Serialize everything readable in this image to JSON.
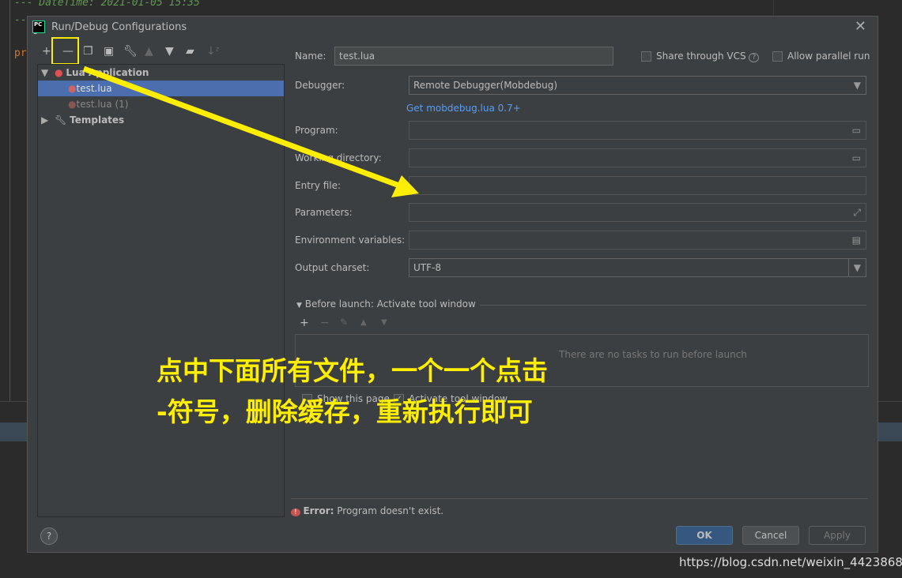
{
  "editor": {
    "comment_line": "--- DateTime: 2021-01-05 15:35",
    "dash_line": "--",
    "code_fragment": "pr"
  },
  "dialog": {
    "title": "Run/Debug Configurations",
    "toolbar": [
      "add-icon",
      "remove-icon",
      "copy-icon",
      "save-icon",
      "wrench-icon",
      "move-up-icon",
      "move-down-icon",
      "folder-add-icon",
      "sort-icon"
    ],
    "tree": {
      "group": "Lua Application",
      "items": [
        {
          "label": "test.lua",
          "selected": true
        },
        {
          "label": "test.lua (1)",
          "selected": false
        }
      ],
      "templates": "Templates"
    },
    "form": {
      "name_label": "Name:",
      "name_value": "test.lua",
      "share_vcs": "Share through VCS",
      "allow_parallel": "Allow parallel run",
      "debugger_label": "Debugger:",
      "debugger_value": "Remote Debugger(Mobdebug)",
      "mobdebug_link": "Get mobdebug.lua 0.7+",
      "program_label": "Program:",
      "program_value": "",
      "workdir_label": "Working directory:",
      "workdir_value": "",
      "entry_label": "Entry file:",
      "entry_value": "",
      "params_label": "Parameters:",
      "params_value": "",
      "env_label": "Environment variables:",
      "env_value": "",
      "charset_label": "Output charset:",
      "charset_value": "UTF-8"
    },
    "before_launch": {
      "title": "Before launch: Activate tool window",
      "empty": "There are no tasks to run before launch",
      "show_page": "Show this page",
      "activate_tool": "Activate tool window",
      "show_page_checked": false,
      "activate_tool_checked": true
    },
    "error": {
      "label": "Error:",
      "message": "Program doesn't exist."
    },
    "buttons": {
      "help": "?",
      "ok": "OK",
      "cancel": "Cancel",
      "apply": "Apply"
    }
  },
  "annotation": {
    "line1": "点中下面所有文件，一个一个点击",
    "line2": "-符号，删除缓存，重新执行即可",
    "color": "#ffee00"
  },
  "watermark": "https://blog.csdn.net/weixin_44238683"
}
